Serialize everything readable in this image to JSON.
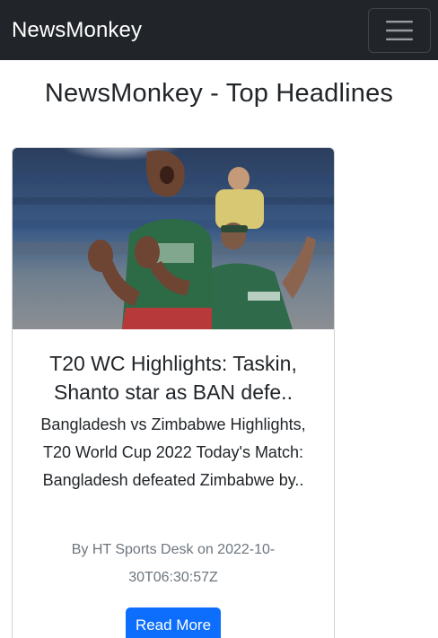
{
  "navbar": {
    "brand": "NewsMonkey",
    "toggler_icon": "hamburger-icon",
    "background": "#212529"
  },
  "page": {
    "title": "NewsMonkey - Top Headlines"
  },
  "articles": [
    {
      "title": "T20 WC Highlights: Taskin, Shanto star as BAN defe..",
      "description": "Bangladesh vs Zimbabwe Highlights, T20 World Cup 2022 Today's Match: Bangladesh defeated Zimbabwe by..",
      "author_line": "By HT Sports Desk on 2022-10-30T06:30:57Z",
      "read_more_label": "Read More",
      "image_subject": "cricketer-celebrating-photo"
    }
  ],
  "colors": {
    "primary_button": "#0d6efd",
    "muted_text": "#6c757d"
  }
}
